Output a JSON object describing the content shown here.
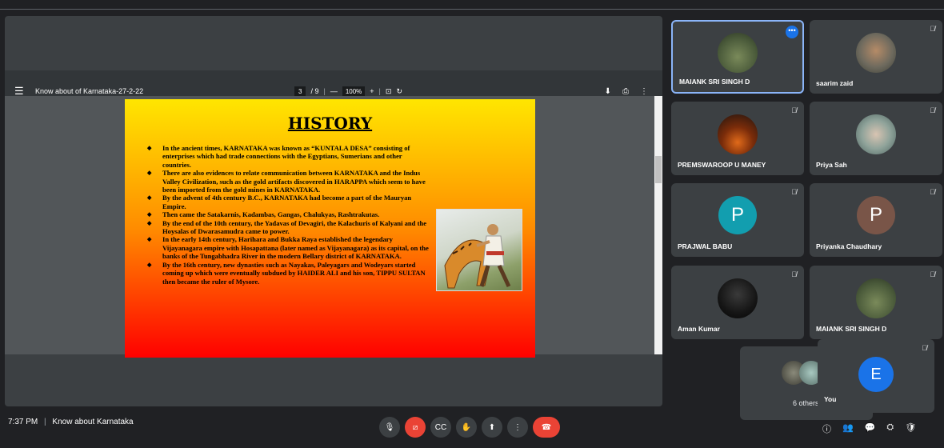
{
  "pdf_viewer": {
    "document_title": "Know about of Karnataka-27-2-22",
    "page_current": "3",
    "page_total": "/ 9",
    "zoom": "100%",
    "zoom_out": "—",
    "zoom_in": "+"
  },
  "slide": {
    "title": "HISTORY",
    "bullets": [
      "In the ancient times, KARNATAKA was known as “KUNTALA DESA” consisting of enterprises which had trade connections with the Egyptians, Sumerians and other countries.",
      "There are also evidences to relate communication between KARNATAKA and the Indus Valley Civilization, such as the gold artifacts discovered in HARAPPA which seem to have been imported from the gold mines in KARNATAKA.",
      "By the advent of 4th century B.C., KARNATAKA had become a part of the Mauryan Empire.",
      "Then came the Satakarnis, Kadambas, Gangas, Chalukyas, Rashtrakutas.",
      "By the end of the 10th century, the Yadavas of Devagiri, the Kalachuris of Kalyani and the Hoysalas of Dwarasamudra came to power.",
      "In the early 14th century, Harihara and Bukka Raya established the legendary Vijayanagara empire with Hosapattana (later named as Vijayanagara) as its capital, on the banks of the Tungabhadra River in the modern Bellary district of KARNATAKA.",
      "By the 16th century, new dynasties such as Nayakas, Paleyagars and Wodeyars started coming up which were eventually subdued by HAIDER ALI and his son, TIPPU SULTAN then became the ruler of Mysore."
    ]
  },
  "participants": [
    {
      "name": "MAIANK SRI SINGH D",
      "type": "photo"
    },
    {
      "name": "saarim zaid",
      "type": "photo"
    },
    {
      "name": "PREMSWAROOP U MANEY",
      "type": "photo"
    },
    {
      "name": "Priya Sah",
      "type": "photo"
    },
    {
      "name": "PRAJWAL BABU",
      "type": "letter",
      "letter": "P",
      "color": "#129eaf"
    },
    {
      "name": "Priyanka Chaudhary",
      "type": "letter",
      "letter": "P",
      "color": "#795548"
    },
    {
      "name": "Aman Kumar",
      "type": "photo"
    },
    {
      "name": "MAIANK SRI SINGH D",
      "type": "photo"
    }
  ],
  "others_label": "6 others",
  "self_tile": {
    "name": "You",
    "letter": "E",
    "color": "#1a73e8"
  },
  "status": {
    "time": "7:37 PM",
    "separator": "|",
    "meeting": "Know about Karnataka"
  },
  "icons": {
    "mic": "mic-icon",
    "camera_off": "camera-off-icon",
    "captions": "captions-icon",
    "raise_hand": "raise-hand-icon",
    "present": "present-icon",
    "more": "more-options-icon",
    "end_call": "end-call-icon",
    "info": "info-icon",
    "people": "people-icon",
    "chat": "chat-icon",
    "activities": "activities-icon",
    "host": "host-controls-icon"
  }
}
